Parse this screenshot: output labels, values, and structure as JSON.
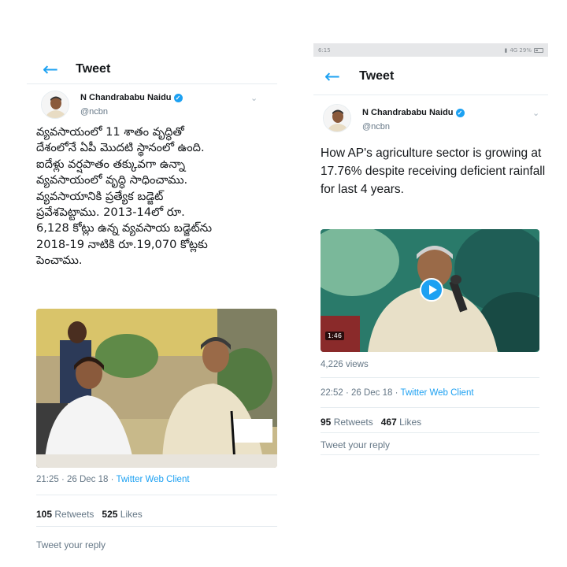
{
  "left_tweet": {
    "header_title": "Tweet",
    "author_name": "N Chandrababu Naidu",
    "handle": "@ncbn",
    "text_lines": [
      "వ్యవసాయంలో 11 శాతం వృద్ధితో",
      "దేశంలోనే ఏపీ మొదటి స్థానంలో ఉంది.",
      "ఐదేళ్లు వర్షపాతం తక్కువగా ఉన్నా",
      "వ్యవసాయంలో వృద్ధి సాధించాము.",
      "వ్యవసాయానికి ప్రత్యేక బడ్జెట్",
      "ప్రవేశపెట్టాము. 2013-14లో రూ.",
      "6,128 కోట్లు ఉన్న వ్యవసాయ బడ్జెట్‌ను",
      "2018-19 నాటికి రూ.19,070 కోట్లకు",
      "పెంచాము."
    ],
    "time": "21:25 · 26 Dec 18 · ",
    "client": "Twitter Web Client",
    "retweets_count": "105",
    "retweets_label": "Retweets",
    "likes_count": "525",
    "likes_label": "Likes",
    "reply_placeholder": "Tweet your reply"
  },
  "right_tweet": {
    "status_time": "6:15",
    "status_icons": "4G  29%",
    "header_title": "Tweet",
    "author_name": "N Chandrababu Naidu",
    "handle": "@ncbn",
    "text": "How AP's agriculture sector is growing at 17.76% despite receiving deficient rainfall for last 4 years.",
    "video_duration": "1:46",
    "views": "4,226 views",
    "time": "22:52 · 26 Dec 18 · ",
    "client": "Twitter Web Client",
    "retweets_count": "95",
    "retweets_label": "Retweets",
    "likes_count": "467",
    "likes_label": "Likes",
    "reply_placeholder": "Tweet your reply"
  },
  "colors": {
    "accent": "#1da1f2",
    "text": "#14171a",
    "muted": "#657786",
    "divider": "#e6ecf0"
  },
  "icons": [
    "back-arrow-icon",
    "verified-badge-icon",
    "chevron-down-icon",
    "play-icon",
    "signal-icon",
    "battery-icon"
  ]
}
